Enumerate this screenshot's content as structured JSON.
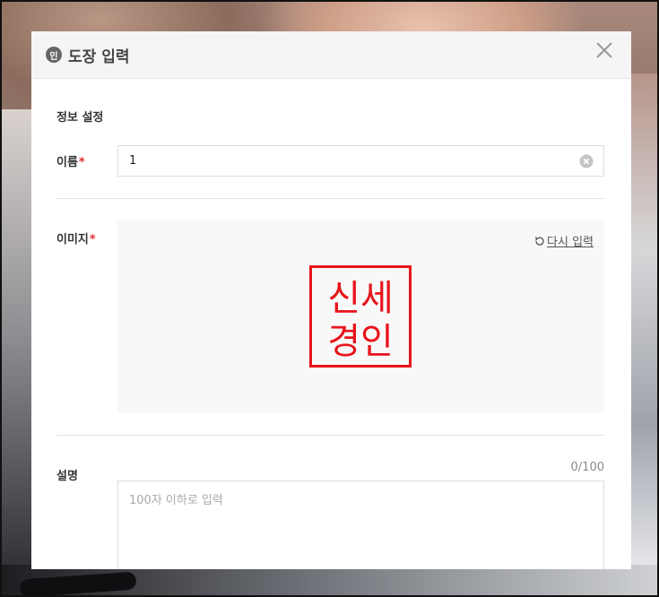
{
  "dialog": {
    "badge": "인",
    "title": "도장 입력"
  },
  "section": {
    "title": "정보 설정"
  },
  "fields": {
    "name": {
      "label": "이름",
      "required_mark": "*",
      "value": "1"
    },
    "image": {
      "label": "이미지",
      "required_mark": "*",
      "reset_label": "다시 입력",
      "seal_text_top": "신세",
      "seal_text_bottom": "경인",
      "seal_color": "#e8141b"
    },
    "description": {
      "label": "설명",
      "counter": "0/100",
      "placeholder": "100자 이하로 입력"
    }
  },
  "icons": {
    "header": "seal-badge-icon",
    "close": "close-icon",
    "clear": "clear-circle-icon",
    "reset": "reset-arrow-icon"
  }
}
